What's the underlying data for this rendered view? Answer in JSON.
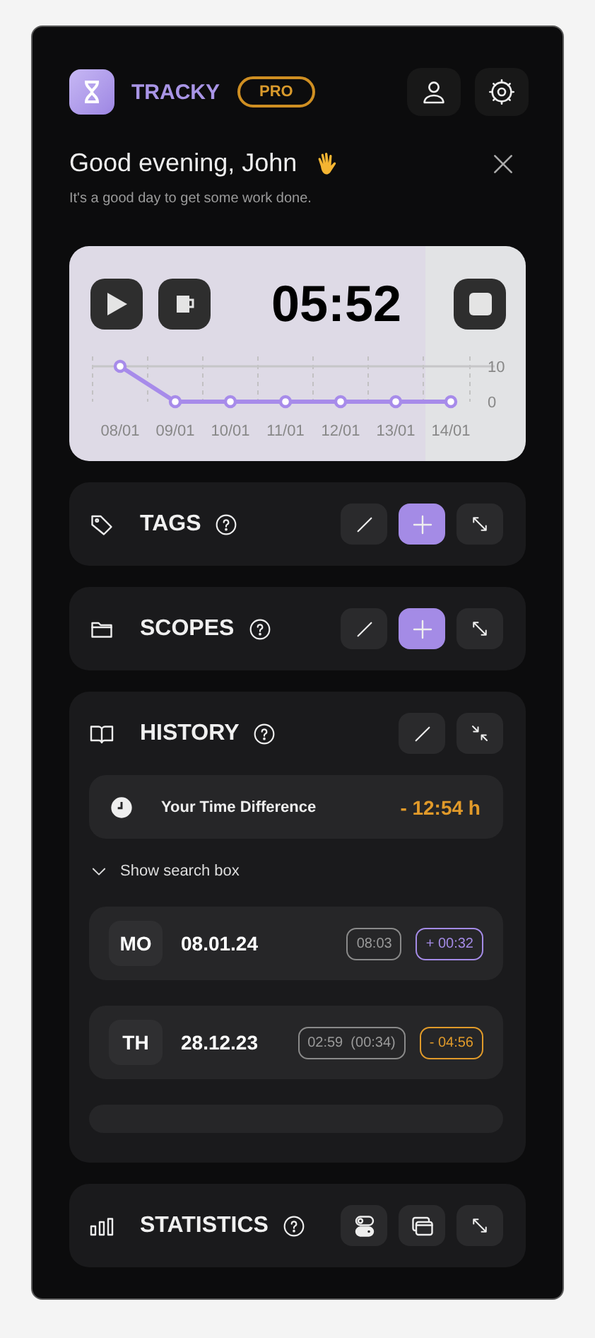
{
  "header": {
    "app_name": "TRACKY",
    "badge": "PRO"
  },
  "greeting": {
    "title": "Good evening, John",
    "subtitle": "It's a good day to get some work done."
  },
  "timer": {
    "time": "05:52",
    "chart_data": {
      "type": "line",
      "categories": [
        "08/01",
        "09/01",
        "10/01",
        "11/01",
        "12/01",
        "13/01",
        "14/01"
      ],
      "yticks": [
        0,
        10
      ],
      "ylim": [
        0,
        10
      ],
      "series": [
        {
          "color": "#a78bea",
          "marker": "circle",
          "values": [
            10,
            0,
            0,
            0,
            0,
            0,
            0
          ]
        }
      ]
    }
  },
  "sections": [
    {
      "kind": "tags",
      "title": "TAGS",
      "expanded": false,
      "actions": [
        {
          "kind": "edit"
        },
        {
          "kind": "add"
        },
        {
          "kind": "expand"
        }
      ]
    },
    {
      "kind": "scopes",
      "title": "SCOPES",
      "expanded": false,
      "actions": [
        {
          "kind": "edit"
        },
        {
          "kind": "add"
        },
        {
          "kind": "expand"
        }
      ]
    },
    {
      "kind": "history",
      "title": "HISTORY",
      "expanded": true,
      "actions": [
        {
          "kind": "edit"
        },
        {
          "kind": "collapse"
        }
      ],
      "summary": {
        "label": "Your Time Difference",
        "value": "- 12:54 h"
      },
      "search_toggle": "Show search box",
      "rows": [
        {
          "day": "MO",
          "date": "08.01.24",
          "worked": "08:03",
          "difference": "+ 00:32",
          "color": "#a48be6"
        },
        {
          "day": "TH",
          "date": "28.12.23",
          "worked": "02:59  (00:34)",
          "difference": "- 04:56",
          "color": "#e09a2a"
        }
      ]
    },
    {
      "kind": "statistics",
      "title": "STATISTICS",
      "expanded": false,
      "actions": [
        {
          "kind": "toggle"
        },
        {
          "kind": "windows"
        },
        {
          "kind": "expand"
        }
      ]
    }
  ]
}
